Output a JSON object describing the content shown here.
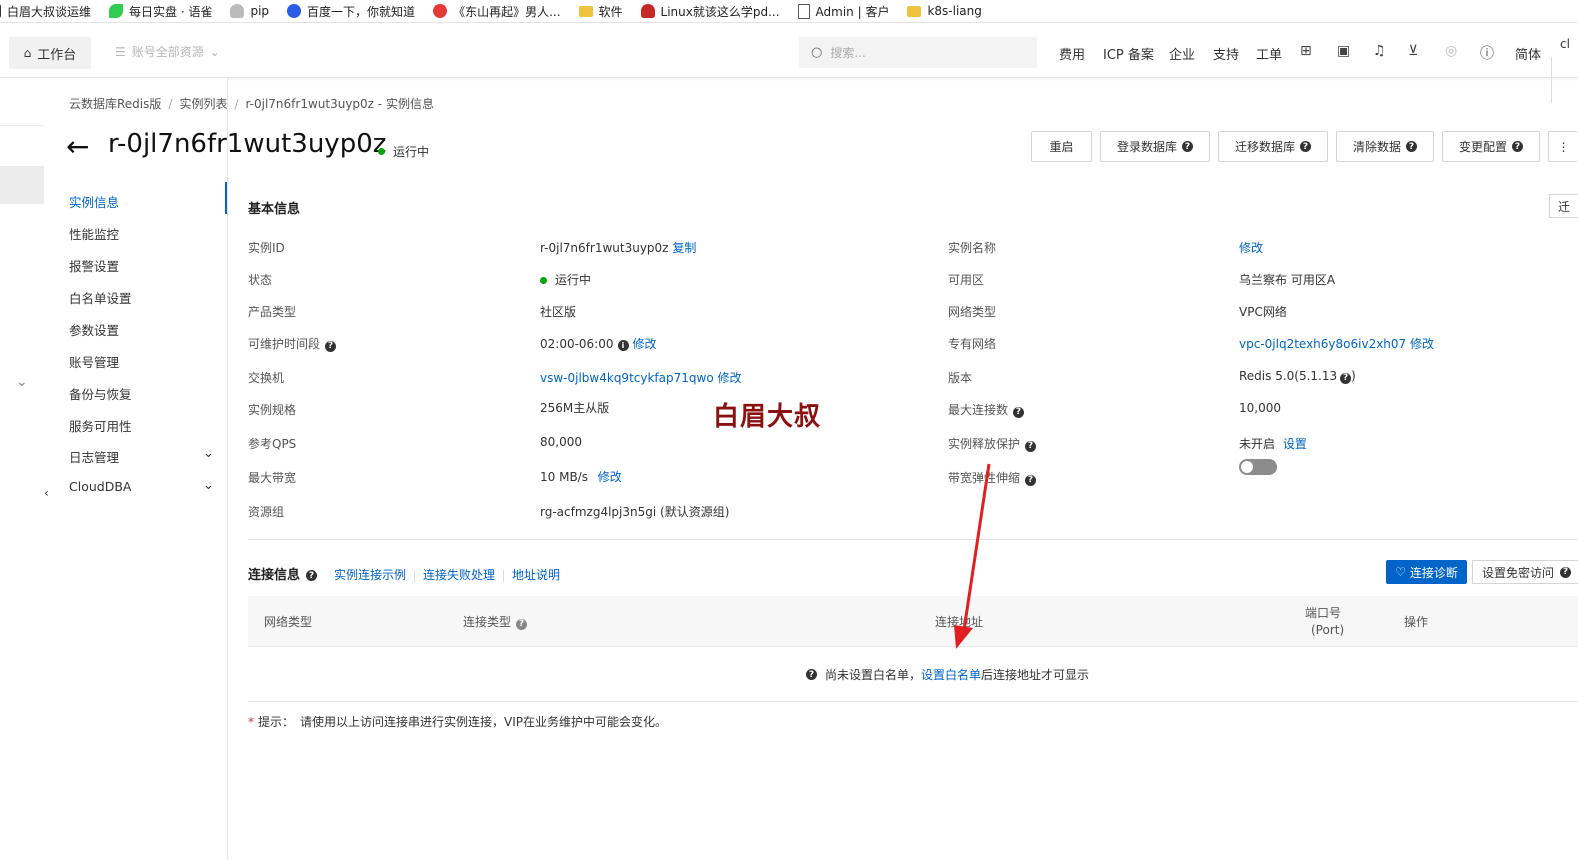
{
  "bookmarks": [
    {
      "label": "白眉大叔谈运维",
      "icon": "bookmark-icon",
      "color": "#333333"
    },
    {
      "label": "每日实盘 · 语雀",
      "icon": "yuque-icon",
      "color": "#31cc52"
    },
    {
      "label": "pip",
      "icon": "user-icon",
      "color": "#999999"
    },
    {
      "label": "百度一下，你就知道",
      "icon": "baidu-paw-icon",
      "color": "#2b5ce6"
    },
    {
      "label": "《东山再起》男人...",
      "icon": "play-icon",
      "color": "#e53935"
    },
    {
      "label": "软件",
      "icon": "folder-icon",
      "color": "#f0c23d"
    },
    {
      "label": "Linux就该这么学pd...",
      "icon": "redhat-icon",
      "color": "#c62828"
    },
    {
      "label": "Admin | 客户",
      "icon": "page-icon",
      "color": "#555555"
    },
    {
      "label": "k8s-liang",
      "icon": "folder-icon",
      "color": "#f0c23d"
    }
  ],
  "header": {
    "workbench": "工作台",
    "account_scope": "账号全部资源",
    "search_placeholder": "搜索...",
    "nav": [
      "费用",
      "ICP 备案",
      "企业",
      "支持",
      "工单"
    ],
    "lang": "简体",
    "cut_text": "cl"
  },
  "breadcrumb": [
    "云数据库Redis版",
    "实例列表",
    "r-0jl7n6fr1wut3uyp0z - 实例信息"
  ],
  "title": "r-0jl7n6fr1wut3uyp0z",
  "status": "运行中",
  "actions": [
    {
      "label": "重启",
      "help": false
    },
    {
      "label": "登录数据库",
      "help": true
    },
    {
      "label": "迁移数据库",
      "help": true
    },
    {
      "label": "清除数据",
      "help": true
    },
    {
      "label": "变更配置",
      "help": true
    }
  ],
  "menu": [
    {
      "label": "实例信息",
      "active": true,
      "expand": false
    },
    {
      "label": "性能监控",
      "active": false,
      "expand": false
    },
    {
      "label": "报警设置",
      "active": false,
      "expand": false
    },
    {
      "label": "白名单设置",
      "active": false,
      "expand": false
    },
    {
      "label": "参数设置",
      "active": false,
      "expand": false
    },
    {
      "label": "账号管理",
      "active": false,
      "expand": false
    },
    {
      "label": "备份与恢复",
      "active": false,
      "expand": false
    },
    {
      "label": "服务可用性",
      "active": false,
      "expand": false
    },
    {
      "label": "日志管理",
      "active": false,
      "expand": true
    },
    {
      "label": "CloudDBA",
      "active": false,
      "expand": true
    }
  ],
  "basic": {
    "title": "基本信息",
    "edge_tab": "迁",
    "copy": "复制",
    "modify": "修改",
    "set": "设置",
    "left": [
      {
        "label": "实例ID",
        "value": "r-0jl7n6fr1wut3uyp0z"
      },
      {
        "label": "状态",
        "value": "运行中"
      },
      {
        "label": "产品类型",
        "value": "社区版"
      },
      {
        "label": "可维护时间段",
        "value": "02:00-06:00"
      },
      {
        "label": "交换机",
        "value": "vsw-0jlbw4kq9tcykfap71qwo"
      },
      {
        "label": "实例规格",
        "value": "256M主从版"
      },
      {
        "label": "参考QPS",
        "value": "80,000"
      },
      {
        "label": "最大带宽",
        "value": "10 MB/s"
      },
      {
        "label": "资源组",
        "value": "rg-acfmzg4lpj3n5gi (默认资源组)"
      }
    ],
    "right": [
      {
        "label": "实例名称",
        "value": ""
      },
      {
        "label": "可用区",
        "value": "乌兰察布 可用区A"
      },
      {
        "label": "网络类型",
        "value": "VPC网络"
      },
      {
        "label": "专有网络",
        "value": "vpc-0jlq2texh6y8o6iv2xh07"
      },
      {
        "label": "版本",
        "value": "Redis 5.0(5.1.13"
      },
      {
        "label": "最大连接数",
        "value": "10,000"
      },
      {
        "label": "实例释放保护",
        "value": "未开启"
      },
      {
        "label": "带宽弹性伸缩",
        "value": ""
      }
    ],
    "release_protection_on": false
  },
  "watermark": "白眉大叔",
  "connection": {
    "title": "连接信息",
    "links": [
      "实例连接示例",
      "连接失败处理",
      "地址说明"
    ],
    "diag_button": "连接诊断",
    "pw_button": "设置免密访问",
    "columns": [
      "网络类型",
      "连接类型",
      "连接地址",
      "端口号",
      "(Port)",
      "操作"
    ],
    "empty_prefix": "尚未设置白名单，",
    "empty_link": "设置白名单",
    "empty_suffix": "后连接地址才可显示"
  },
  "tip": {
    "star": "*",
    "label": "提示：",
    "text": "请使用以上访问连接串进行实例连接，VIP在业务维护中可能会变化。"
  },
  "colors": {
    "accent": "#0064c8",
    "running": "#00a700",
    "annotation": "#e02020",
    "watermark": "#8b1010"
  }
}
